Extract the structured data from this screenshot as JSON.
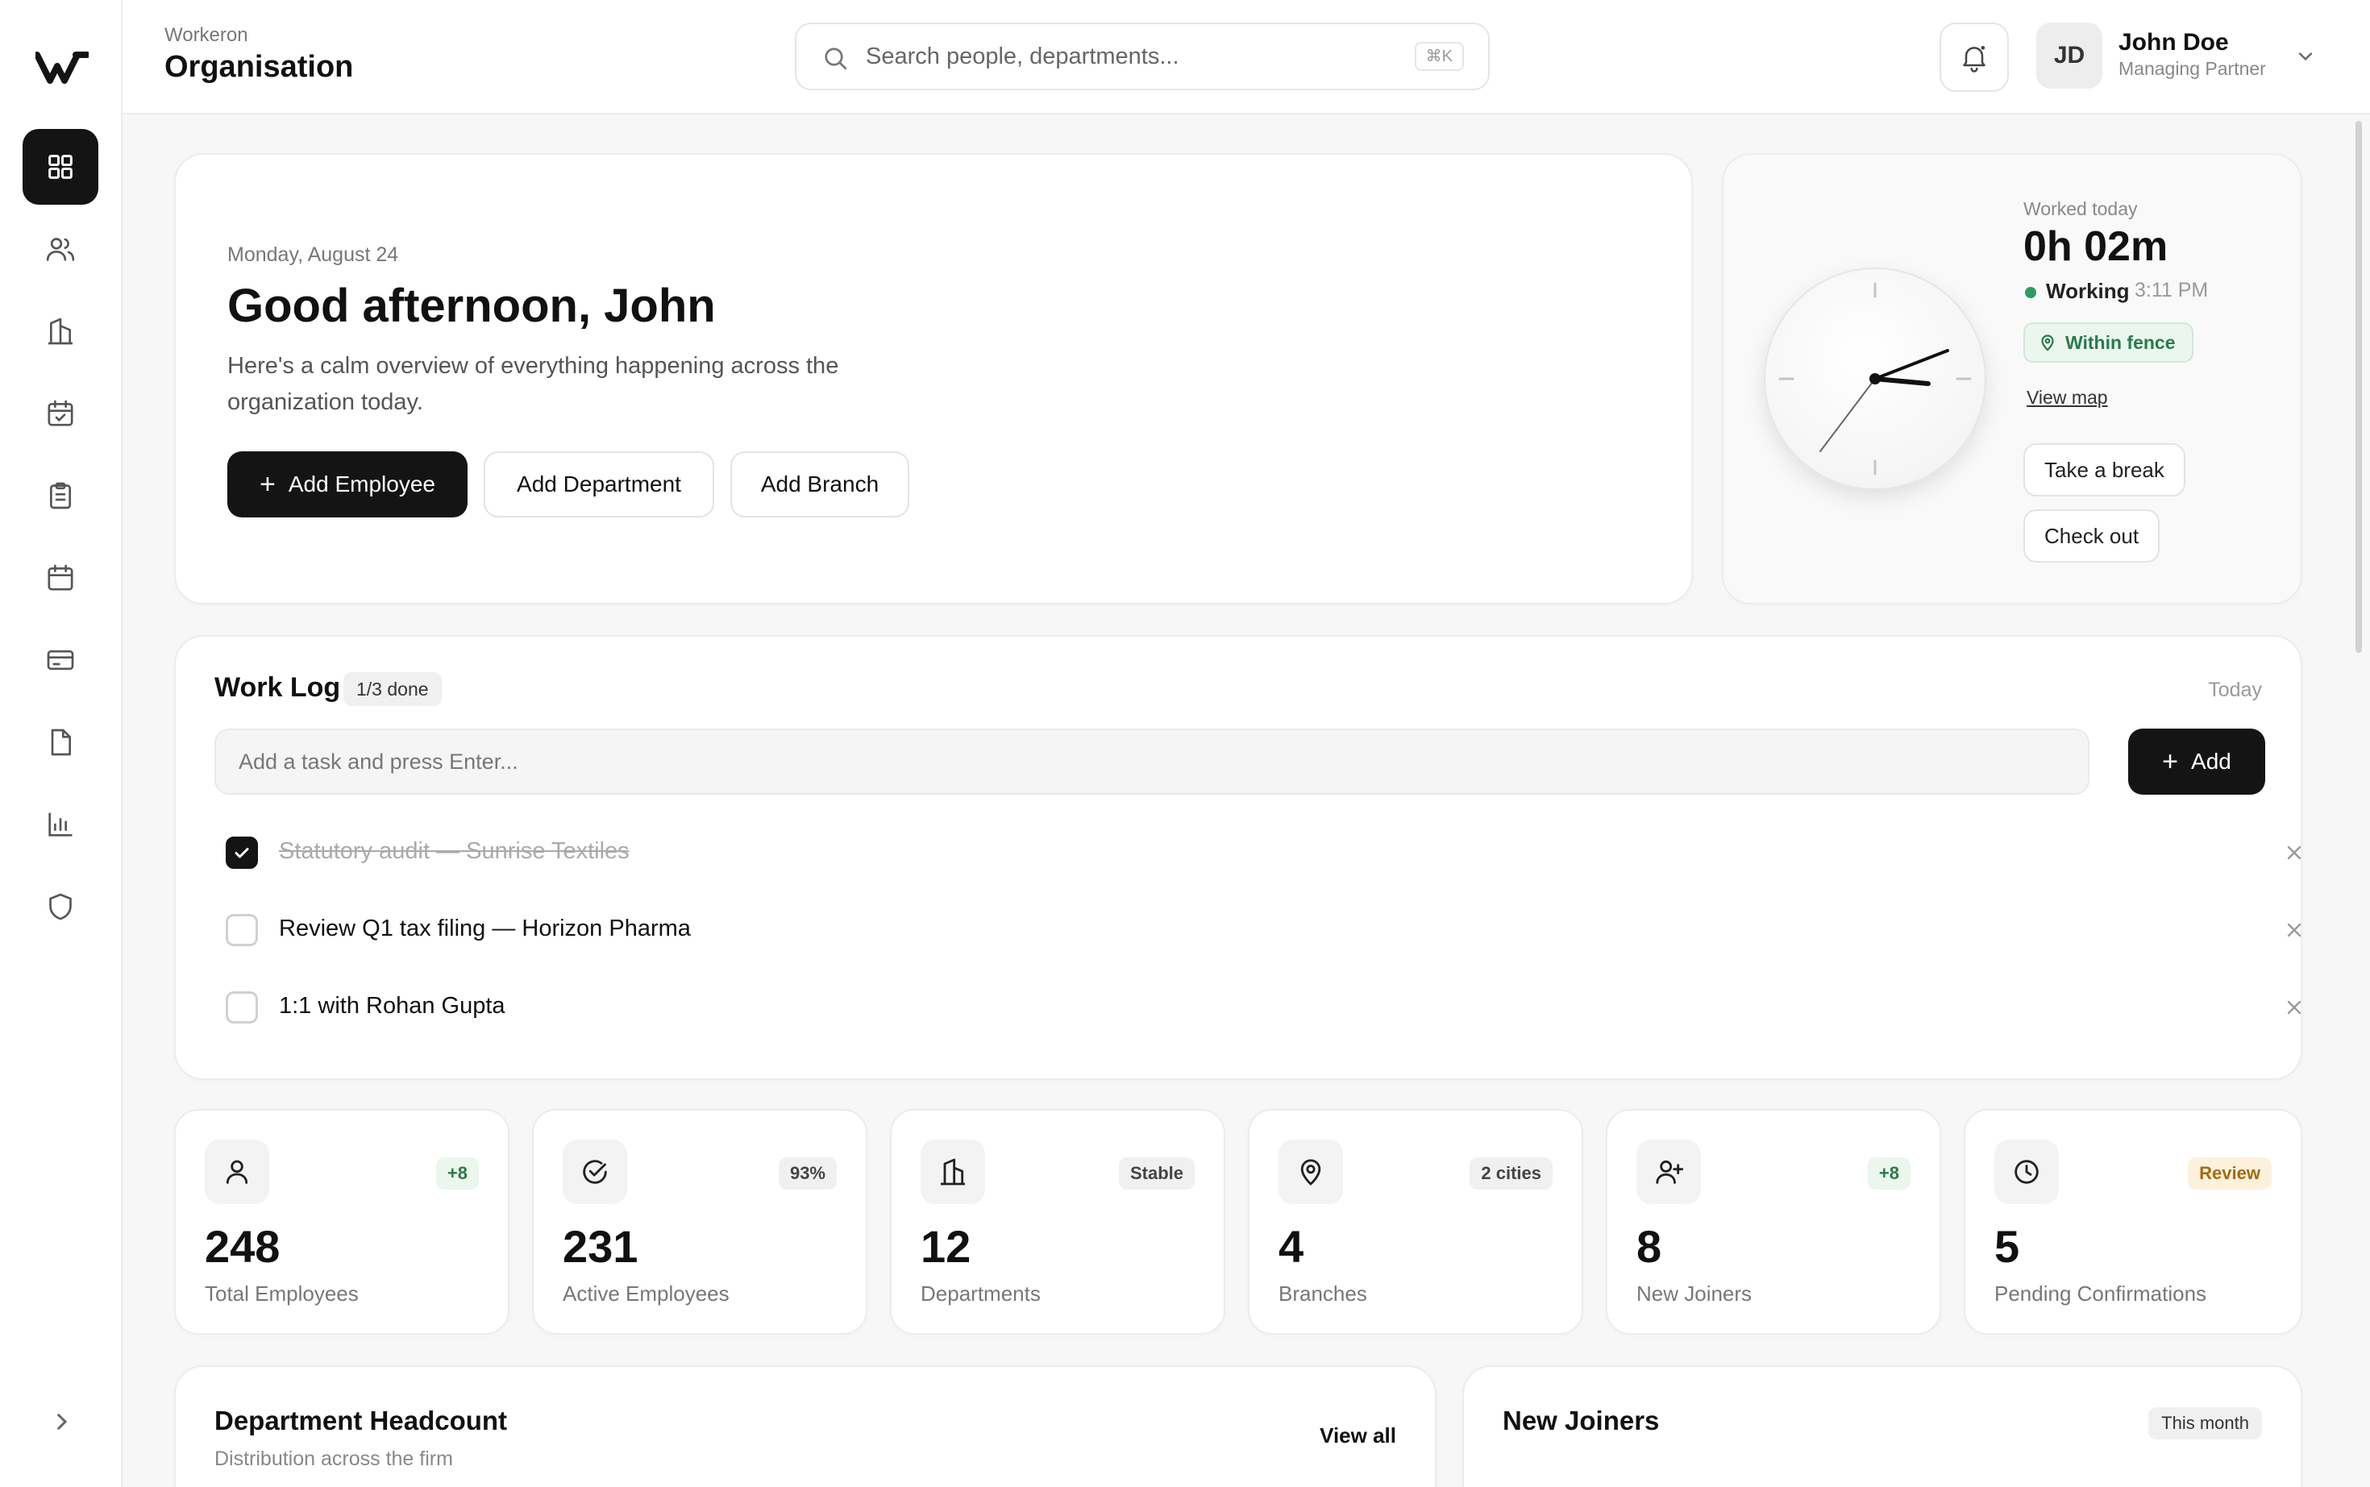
{
  "brand": {
    "subtitle": "Workeron",
    "title": "Organisation"
  },
  "search": {
    "placeholder": "Search people, departments...",
    "shortcut": "⌘K"
  },
  "user": {
    "initials": "JD",
    "name": "John Doe",
    "role": "Managing Partner"
  },
  "sidebar": {
    "items": [
      {
        "name": "dashboard",
        "icon": "grid-icon",
        "active": true
      },
      {
        "name": "people",
        "icon": "users-icon",
        "active": false
      },
      {
        "name": "departments",
        "icon": "building-icon",
        "active": false
      },
      {
        "name": "attendance",
        "icon": "calendar-check-icon",
        "active": false
      },
      {
        "name": "tasks",
        "icon": "clipboard-icon",
        "active": false
      },
      {
        "name": "calendar",
        "icon": "calendar-icon",
        "active": false
      },
      {
        "name": "payroll",
        "icon": "credit-card-icon",
        "active": false
      },
      {
        "name": "documents",
        "icon": "file-icon",
        "active": false
      },
      {
        "name": "reports",
        "icon": "bar-chart-icon",
        "active": false
      },
      {
        "name": "security",
        "icon": "shield-icon",
        "active": false
      }
    ]
  },
  "greeting": {
    "date": "Monday, August 24",
    "title": "Good afternoon, John",
    "description": "Here's a calm overview of everything happening across the organization today.",
    "buttons": {
      "add_employee": "Add Employee",
      "add_department": "Add Department",
      "add_branch": "Add Branch"
    }
  },
  "clock": {
    "worked_label": "Worked today",
    "worked_value": "0h 02m",
    "status": "Working",
    "time": "3:11 PM",
    "fence": "Within fence",
    "view_map": "View map",
    "take_break": "Take a break",
    "check_out": "Check out"
  },
  "worklog": {
    "title": "Work Log",
    "progress": "1/3 done",
    "period": "Today",
    "input_placeholder": "Add a task and press Enter...",
    "add_label": "Add",
    "tasks": [
      {
        "label": "Statutory audit — Sunrise Textiles",
        "done": true
      },
      {
        "label": "Review Q1 tax filing — Horizon Pharma",
        "done": false
      },
      {
        "label": "1:1 with Rohan Gupta",
        "done": false
      }
    ]
  },
  "stats": [
    {
      "value": "248",
      "label": "Total Employees",
      "badge": "+8",
      "tone": "green",
      "icon": "user-icon"
    },
    {
      "value": "231",
      "label": "Active Employees",
      "badge": "93%",
      "tone": "neutral",
      "icon": "check-circle-icon"
    },
    {
      "value": "12",
      "label": "Departments",
      "badge": "Stable",
      "tone": "neutral",
      "icon": "building-icon"
    },
    {
      "value": "4",
      "label": "Branches",
      "badge": "2 cities",
      "tone": "neutral",
      "icon": "map-pin-icon"
    },
    {
      "value": "8",
      "label": "New Joiners",
      "badge": "+8",
      "tone": "green",
      "icon": "user-plus-icon"
    },
    {
      "value": "5",
      "label": "Pending Confirmations",
      "badge": "Review",
      "tone": "amber",
      "icon": "clock-icon"
    }
  ],
  "dept_headcount": {
    "title": "Department Headcount",
    "subtitle": "Distribution across the firm",
    "link": "View all"
  },
  "new_joiners": {
    "title": "New Joiners",
    "period": "This month"
  },
  "colors": {
    "accent": "#141414",
    "success": "#2a9d62",
    "warning": "#a36b12",
    "background": "#f7f7f7"
  }
}
